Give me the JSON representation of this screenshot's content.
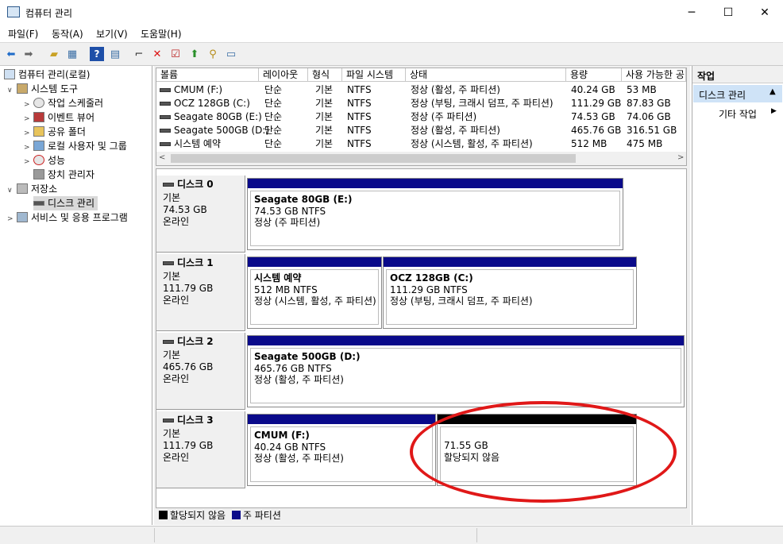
{
  "window": {
    "title": "컴퓨터 관리",
    "min": "─",
    "max": "☐",
    "close": "✕"
  },
  "menu": [
    "파일(F)",
    "동작(A)",
    "보기(V)",
    "도움말(H)"
  ],
  "tree": {
    "root": "컴퓨터 관리(로컬)",
    "system_tools": "시스템 도구",
    "task_scheduler": "작업 스케줄러",
    "event_viewer": "이벤트 뷰어",
    "shared_folders": "공유 폴더",
    "local_users": "로컬 사용자 및 그룹",
    "performance": "성능",
    "device_manager": "장치 관리자",
    "storage": "저장소",
    "disk_management": "디스크 관리",
    "services": "서비스 및 응용 프로그램"
  },
  "volumes": {
    "headers": [
      "볼륨",
      "레이아웃",
      "형식",
      "파일 시스템",
      "상태",
      "용량",
      "사용 가능한 공"
    ],
    "rows": [
      [
        "CMUM (F:)",
        "단순",
        "기본",
        "NTFS",
        "정상 (활성, 주 파티션)",
        "40.24 GB",
        "53 MB"
      ],
      [
        "OCZ 128GB (C:)",
        "단순",
        "기본",
        "NTFS",
        "정상 (부팅, 크래시 덤프, 주 파티션)",
        "111.29 GB",
        "87.83 GB"
      ],
      [
        "Seagate 80GB (E:)",
        "단순",
        "기본",
        "NTFS",
        "정상 (주 파티션)",
        "74.53 GB",
        "74.06 GB"
      ],
      [
        "Seagate 500GB (D:)",
        "단순",
        "기본",
        "NTFS",
        "정상 (활성, 주 파티션)",
        "465.76 GB",
        "316.51 GB"
      ],
      [
        "시스템 예약",
        "단순",
        "기본",
        "NTFS",
        "정상 (시스템, 활성, 주 파티션)",
        "512 MB",
        "475 MB"
      ]
    ]
  },
  "disks": [
    {
      "name": "디스크 0",
      "type": "기본",
      "size": "74.53 GB",
      "state": "온라인",
      "parts": [
        {
          "name": "Seagate 80GB  (E:)",
          "size": "74.53 GB NTFS",
          "status": "정상 (주 파티션)"
        }
      ]
    },
    {
      "name": "디스크 1",
      "type": "기본",
      "size": "111.79 GB",
      "state": "온라인",
      "parts": [
        {
          "name": "시스템 예약",
          "size": "512 MB NTFS",
          "status": "정상 (시스템, 활성, 주 파티션)"
        },
        {
          "name": "OCZ 128GB  (C:)",
          "size": "111.29 GB NTFS",
          "status": "정상 (부팅, 크래시 덤프, 주 파티션)"
        }
      ]
    },
    {
      "name": "디스크 2",
      "type": "기본",
      "size": "465.76 GB",
      "state": "온라인",
      "parts": [
        {
          "name": "Seagate 500GB  (D:)",
          "size": "465.76 GB NTFS",
          "status": "정상 (활성, 주 파티션)"
        }
      ]
    },
    {
      "name": "디스크 3",
      "type": "기본",
      "size": "111.79 GB",
      "state": "온라인",
      "parts": [
        {
          "name": "CMUM  (F:)",
          "size": "40.24 GB NTFS",
          "status": "정상 (활성, 주 파티션)"
        },
        {
          "name": "",
          "size": "71.55 GB",
          "status": "할당되지 않음"
        }
      ]
    }
  ],
  "legend": {
    "unallocated": "할당되지 않음",
    "primary": "주 파티션"
  },
  "actions": {
    "header": "작업",
    "selected": "디스크 관리",
    "more": "기타 작업"
  },
  "colors": {
    "primary_bar": "#0a0a8a",
    "unallocated_bar": "#000000",
    "annotation": "#e01818",
    "selection": "#cfe3f7"
  }
}
